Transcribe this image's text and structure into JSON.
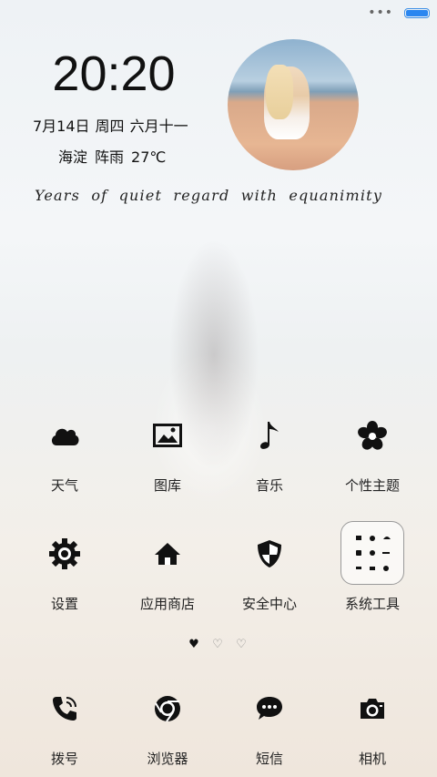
{
  "status_bar": {
    "overflow_icon": "dots-icon",
    "battery_level": 0.95,
    "battery_color": "#2a86f0"
  },
  "widget": {
    "time": "20:20",
    "date": "7月14日",
    "weekday": "周四",
    "lunar": "六月十一",
    "location": "海淀",
    "condition": "阵雨",
    "temperature": "27℃",
    "motto": "Years of quiet regard with equanimity"
  },
  "apps": [
    {
      "label": "天气",
      "icon": "cloud-icon"
    },
    {
      "label": "图库",
      "icon": "gallery-icon"
    },
    {
      "label": "音乐",
      "icon": "music-note-icon"
    },
    {
      "label": "个性主题",
      "icon": "flower-icon"
    },
    {
      "label": "设置",
      "icon": "gear-icon"
    },
    {
      "label": "应用商店",
      "icon": "home-icon"
    },
    {
      "label": "安全中心",
      "icon": "shield-icon"
    },
    {
      "label": "系统工具",
      "icon": "folder-icon"
    }
  ],
  "pager": {
    "pages": 3,
    "active": 1
  },
  "dock": [
    {
      "label": "拨号",
      "icon": "phone-icon"
    },
    {
      "label": "浏览器",
      "icon": "browser-icon"
    },
    {
      "label": "短信",
      "icon": "message-icon"
    },
    {
      "label": "相机",
      "icon": "camera-icon"
    }
  ]
}
